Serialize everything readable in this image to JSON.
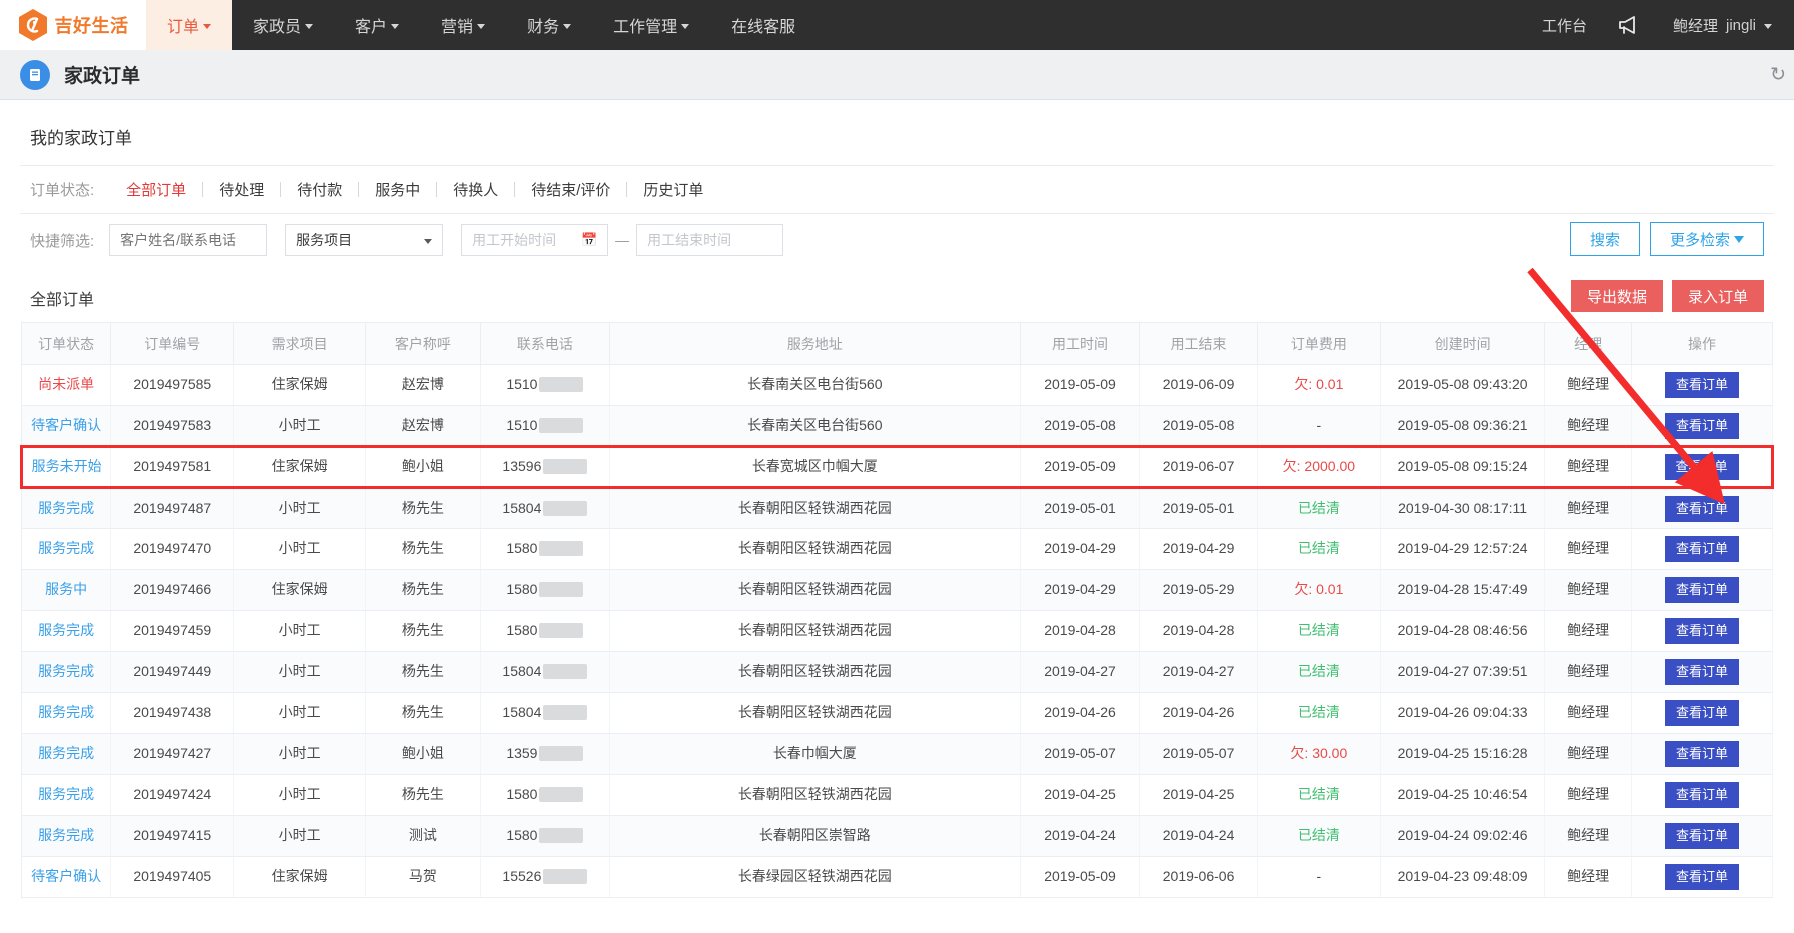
{
  "topnav": {
    "brand": "吉好生活",
    "brand_color": "#f0792b",
    "items": [
      {
        "label": "订单",
        "has_caret": true,
        "active": true
      },
      {
        "label": "家政员",
        "has_caret": true,
        "active": false
      },
      {
        "label": "客户",
        "has_caret": true,
        "active": false
      },
      {
        "label": "营销",
        "has_caret": true,
        "active": false
      },
      {
        "label": "财务",
        "has_caret": true,
        "active": false
      },
      {
        "label": "工作管理",
        "has_caret": true,
        "active": false
      },
      {
        "label": "在线客服",
        "has_caret": false,
        "active": false
      }
    ],
    "workbench": "工作台",
    "horn_icon": "megaphone-icon",
    "user_name": "鲍经理",
    "user_account": "jingli"
  },
  "page_header": {
    "icon": "document-icon",
    "title": "家政订单",
    "refresh_icon": "refresh-icon"
  },
  "card": {
    "title": "我的家政订单",
    "status_filter": {
      "label": "订单状态:",
      "tabs": [
        {
          "label": "全部订单",
          "active": true
        },
        {
          "label": "待处理",
          "active": false
        },
        {
          "label": "待付款",
          "active": false
        },
        {
          "label": "服务中",
          "active": false
        },
        {
          "label": "待换人",
          "active": false
        },
        {
          "label": "待结束/评价",
          "active": false
        },
        {
          "label": "历史订单",
          "active": false
        }
      ]
    },
    "quick_filter": {
      "label": "快捷筛选:",
      "name_phone_placeholder": "客户姓名/联系电话",
      "name_phone_value": "",
      "service_select_value": "服务项目",
      "start_date_placeholder": "用工开始时间",
      "start_date_value": "",
      "date_separator": "—",
      "end_date_placeholder": "用工结束时间",
      "end_date_value": "",
      "search_button": "搜索",
      "more_button": "更多检索"
    },
    "list_header": {
      "title": "全部订单",
      "export_button": "导出数据",
      "create_button": "录入订单"
    }
  },
  "table": {
    "columns": [
      "订单状态",
      "订单编号",
      "需求项目",
      "客户称呼",
      "联系电话",
      "服务地址",
      "用工时间",
      "用工结束",
      "订单费用",
      "创建时间",
      "经理",
      "操作"
    ],
    "action_label": "查看订单",
    "rows": [
      {
        "status": "尚未派单",
        "status_color": "red",
        "order_no": "2019497585",
        "item": "住家保姆",
        "customer": "赵宏博",
        "phone": "1510",
        "address": "长春南关区电台街560",
        "start": "2019-05-09",
        "end": "2019-06-09",
        "fee": "欠: 0.01",
        "fee_color": "red",
        "created": "2019-05-08 09:43:20",
        "manager": "鲍经理"
      },
      {
        "status": "待客户确认",
        "status_color": "blue",
        "order_no": "2019497583",
        "item": "小时工",
        "customer": "赵宏博",
        "phone": "1510",
        "address": "长春南关区电台街560",
        "start": "2019-05-08",
        "end": "2019-05-08",
        "fee": "-",
        "fee_color": "plain",
        "created": "2019-05-08 09:36:21",
        "manager": "鲍经理"
      },
      {
        "status": "服务未开始",
        "status_color": "blue",
        "order_no": "2019497581",
        "item": "住家保姆",
        "customer": "鲍小姐",
        "phone": "13596",
        "address": "长春宽城区巾帼大厦",
        "start": "2019-05-09",
        "end": "2019-06-07",
        "fee": "欠: 2000.00",
        "fee_color": "red",
        "created": "2019-05-08 09:15:24",
        "manager": "鲍经理",
        "highlighted": true
      },
      {
        "status": "服务完成",
        "status_color": "blue",
        "order_no": "2019497487",
        "item": "小时工",
        "customer": "杨先生",
        "phone": "15804",
        "address": "长春朝阳区轻铁湖西花园",
        "start": "2019-05-01",
        "end": "2019-05-01",
        "fee": "已结清",
        "fee_color": "green",
        "created": "2019-04-30 08:17:11",
        "manager": "鲍经理"
      },
      {
        "status": "服务完成",
        "status_color": "blue",
        "order_no": "2019497470",
        "item": "小时工",
        "customer": "杨先生",
        "phone": "1580",
        "address": "长春朝阳区轻铁湖西花园",
        "start": "2019-04-29",
        "end": "2019-04-29",
        "fee": "已结清",
        "fee_color": "green",
        "created": "2019-04-29 12:57:24",
        "manager": "鲍经理"
      },
      {
        "status": "服务中",
        "status_color": "blue",
        "order_no": "2019497466",
        "item": "住家保姆",
        "customer": "杨先生",
        "phone": "1580",
        "address": "长春朝阳区轻铁湖西花园",
        "start": "2019-04-29",
        "end": "2019-05-29",
        "fee": "欠: 0.01",
        "fee_color": "red",
        "created": "2019-04-28 15:47:49",
        "manager": "鲍经理"
      },
      {
        "status": "服务完成",
        "status_color": "blue",
        "order_no": "2019497459",
        "item": "小时工",
        "customer": "杨先生",
        "phone": "1580",
        "address": "长春朝阳区轻铁湖西花园",
        "start": "2019-04-28",
        "end": "2019-04-28",
        "fee": "已结清",
        "fee_color": "green",
        "created": "2019-04-28 08:46:56",
        "manager": "鲍经理"
      },
      {
        "status": "服务完成",
        "status_color": "blue",
        "order_no": "2019497449",
        "item": "小时工",
        "customer": "杨先生",
        "phone": "15804",
        "address": "长春朝阳区轻铁湖西花园",
        "start": "2019-04-27",
        "end": "2019-04-27",
        "fee": "已结清",
        "fee_color": "green",
        "created": "2019-04-27 07:39:51",
        "manager": "鲍经理"
      },
      {
        "status": "服务完成",
        "status_color": "blue",
        "order_no": "2019497438",
        "item": "小时工",
        "customer": "杨先生",
        "phone": "15804",
        "address": "长春朝阳区轻铁湖西花园",
        "start": "2019-04-26",
        "end": "2019-04-26",
        "fee": "已结清",
        "fee_color": "green",
        "created": "2019-04-26 09:04:33",
        "manager": "鲍经理"
      },
      {
        "status": "服务完成",
        "status_color": "blue",
        "order_no": "2019497427",
        "item": "小时工",
        "customer": "鲍小姐",
        "phone": "1359",
        "address": "长春巾帼大厦",
        "start": "2019-05-07",
        "end": "2019-05-07",
        "fee": "欠: 30.00",
        "fee_color": "red",
        "created": "2019-04-25 15:16:28",
        "manager": "鲍经理"
      },
      {
        "status": "服务完成",
        "status_color": "blue",
        "order_no": "2019497424",
        "item": "小时工",
        "customer": "杨先生",
        "phone": "1580",
        "address": "长春朝阳区轻铁湖西花园",
        "start": "2019-04-25",
        "end": "2019-04-25",
        "fee": "已结清",
        "fee_color": "green",
        "created": "2019-04-25 10:46:54",
        "manager": "鲍经理"
      },
      {
        "status": "服务完成",
        "status_color": "blue",
        "order_no": "2019497415",
        "item": "小时工",
        "customer": "测试",
        "phone": "1580",
        "address": "长春朝阳区崇智路",
        "start": "2019-04-24",
        "end": "2019-04-24",
        "fee": "已结清",
        "fee_color": "green",
        "created": "2019-04-24 09:02:46",
        "manager": "鲍经理"
      },
      {
        "status": "待客户确认",
        "status_color": "blue",
        "order_no": "2019497405",
        "item": "住家保姆",
        "customer": "马贺",
        "phone": "15526",
        "address": "长春绿园区轻铁湖西花园",
        "start": "2019-05-09",
        "end": "2019-06-06",
        "fee": "-",
        "fee_color": "plain",
        "created": "2019-04-23 09:48:09",
        "manager": "鲍经理"
      }
    ]
  },
  "annotation": {
    "arrow_color": "#f32c2c",
    "highlight_box_color": "#f32c2c"
  }
}
